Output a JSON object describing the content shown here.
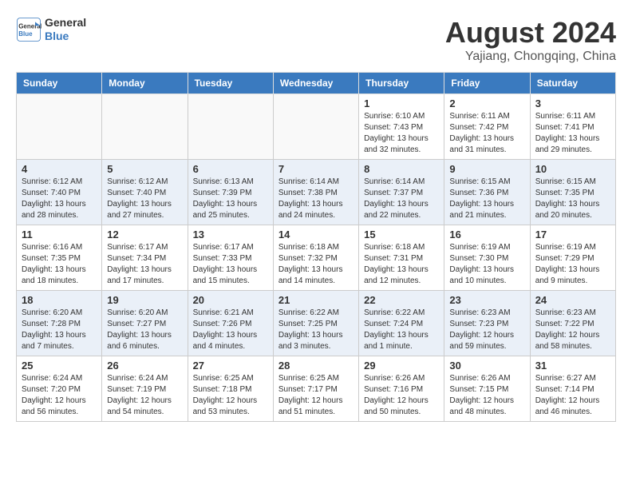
{
  "header": {
    "logo_line1": "General",
    "logo_line2": "Blue",
    "title": "August 2024",
    "location": "Yajiang, Chongqing, China"
  },
  "days_of_week": [
    "Sunday",
    "Monday",
    "Tuesday",
    "Wednesday",
    "Thursday",
    "Friday",
    "Saturday"
  ],
  "weeks": [
    [
      {
        "day": "",
        "info": ""
      },
      {
        "day": "",
        "info": ""
      },
      {
        "day": "",
        "info": ""
      },
      {
        "day": "",
        "info": ""
      },
      {
        "day": "1",
        "info": "Sunrise: 6:10 AM\nSunset: 7:43 PM\nDaylight: 13 hours\nand 32 minutes."
      },
      {
        "day": "2",
        "info": "Sunrise: 6:11 AM\nSunset: 7:42 PM\nDaylight: 13 hours\nand 31 minutes."
      },
      {
        "day": "3",
        "info": "Sunrise: 6:11 AM\nSunset: 7:41 PM\nDaylight: 13 hours\nand 29 minutes."
      }
    ],
    [
      {
        "day": "4",
        "info": "Sunrise: 6:12 AM\nSunset: 7:40 PM\nDaylight: 13 hours\nand 28 minutes."
      },
      {
        "day": "5",
        "info": "Sunrise: 6:12 AM\nSunset: 7:40 PM\nDaylight: 13 hours\nand 27 minutes."
      },
      {
        "day": "6",
        "info": "Sunrise: 6:13 AM\nSunset: 7:39 PM\nDaylight: 13 hours\nand 25 minutes."
      },
      {
        "day": "7",
        "info": "Sunrise: 6:14 AM\nSunset: 7:38 PM\nDaylight: 13 hours\nand 24 minutes."
      },
      {
        "day": "8",
        "info": "Sunrise: 6:14 AM\nSunset: 7:37 PM\nDaylight: 13 hours\nand 22 minutes."
      },
      {
        "day": "9",
        "info": "Sunrise: 6:15 AM\nSunset: 7:36 PM\nDaylight: 13 hours\nand 21 minutes."
      },
      {
        "day": "10",
        "info": "Sunrise: 6:15 AM\nSunset: 7:35 PM\nDaylight: 13 hours\nand 20 minutes."
      }
    ],
    [
      {
        "day": "11",
        "info": "Sunrise: 6:16 AM\nSunset: 7:35 PM\nDaylight: 13 hours\nand 18 minutes."
      },
      {
        "day": "12",
        "info": "Sunrise: 6:17 AM\nSunset: 7:34 PM\nDaylight: 13 hours\nand 17 minutes."
      },
      {
        "day": "13",
        "info": "Sunrise: 6:17 AM\nSunset: 7:33 PM\nDaylight: 13 hours\nand 15 minutes."
      },
      {
        "day": "14",
        "info": "Sunrise: 6:18 AM\nSunset: 7:32 PM\nDaylight: 13 hours\nand 14 minutes."
      },
      {
        "day": "15",
        "info": "Sunrise: 6:18 AM\nSunset: 7:31 PM\nDaylight: 13 hours\nand 12 minutes."
      },
      {
        "day": "16",
        "info": "Sunrise: 6:19 AM\nSunset: 7:30 PM\nDaylight: 13 hours\nand 10 minutes."
      },
      {
        "day": "17",
        "info": "Sunrise: 6:19 AM\nSunset: 7:29 PM\nDaylight: 13 hours\nand 9 minutes."
      }
    ],
    [
      {
        "day": "18",
        "info": "Sunrise: 6:20 AM\nSunset: 7:28 PM\nDaylight: 13 hours\nand 7 minutes."
      },
      {
        "day": "19",
        "info": "Sunrise: 6:20 AM\nSunset: 7:27 PM\nDaylight: 13 hours\nand 6 minutes."
      },
      {
        "day": "20",
        "info": "Sunrise: 6:21 AM\nSunset: 7:26 PM\nDaylight: 13 hours\nand 4 minutes."
      },
      {
        "day": "21",
        "info": "Sunrise: 6:22 AM\nSunset: 7:25 PM\nDaylight: 13 hours\nand 3 minutes."
      },
      {
        "day": "22",
        "info": "Sunrise: 6:22 AM\nSunset: 7:24 PM\nDaylight: 13 hours\nand 1 minute."
      },
      {
        "day": "23",
        "info": "Sunrise: 6:23 AM\nSunset: 7:23 PM\nDaylight: 12 hours\nand 59 minutes."
      },
      {
        "day": "24",
        "info": "Sunrise: 6:23 AM\nSunset: 7:22 PM\nDaylight: 12 hours\nand 58 minutes."
      }
    ],
    [
      {
        "day": "25",
        "info": "Sunrise: 6:24 AM\nSunset: 7:20 PM\nDaylight: 12 hours\nand 56 minutes."
      },
      {
        "day": "26",
        "info": "Sunrise: 6:24 AM\nSunset: 7:19 PM\nDaylight: 12 hours\nand 54 minutes."
      },
      {
        "day": "27",
        "info": "Sunrise: 6:25 AM\nSunset: 7:18 PM\nDaylight: 12 hours\nand 53 minutes."
      },
      {
        "day": "28",
        "info": "Sunrise: 6:25 AM\nSunset: 7:17 PM\nDaylight: 12 hours\nand 51 minutes."
      },
      {
        "day": "29",
        "info": "Sunrise: 6:26 AM\nSunset: 7:16 PM\nDaylight: 12 hours\nand 50 minutes."
      },
      {
        "day": "30",
        "info": "Sunrise: 6:26 AM\nSunset: 7:15 PM\nDaylight: 12 hours\nand 48 minutes."
      },
      {
        "day": "31",
        "info": "Sunrise: 6:27 AM\nSunset: 7:14 PM\nDaylight: 12 hours\nand 46 minutes."
      }
    ]
  ]
}
